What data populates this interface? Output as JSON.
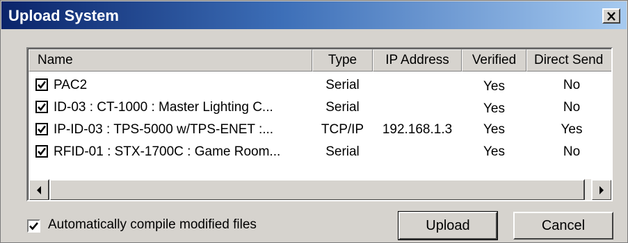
{
  "window": {
    "title": "Upload System"
  },
  "list": {
    "columns": [
      "Name",
      "Type",
      "IP Address",
      "Verified",
      "Direct Send"
    ],
    "rows": [
      {
        "checked": true,
        "name": "PAC2",
        "type": "Serial",
        "ip": "",
        "verified": "Yes",
        "direct_send": "No"
      },
      {
        "checked": true,
        "name": "ID-03 : CT-1000 : Master Lighting C...",
        "type": "Serial",
        "ip": "",
        "verified": "Yes",
        "direct_send": "No"
      },
      {
        "checked": true,
        "name": "IP-ID-03 : TPS-5000 w/TPS-ENET :...",
        "type": "TCP/IP",
        "ip": "192.168.1.3",
        "verified": "Yes",
        "direct_send": "Yes"
      },
      {
        "checked": true,
        "name": "RFID-01 : STX-1700C : Game Room...",
        "type": "Serial",
        "ip": "",
        "verified": "Yes",
        "direct_send": "No"
      }
    ]
  },
  "options": {
    "auto_compile_label": "Automatically compile modified files",
    "auto_compile_checked": true
  },
  "buttons": {
    "upload": "Upload",
    "cancel": "Cancel"
  },
  "icons": {
    "close": "close-icon",
    "scroll_left": "arrow-left-icon",
    "scroll_right": "arrow-right-icon",
    "check": "checkmark-icon"
  },
  "colors": {
    "titlebar_start": "#0a246a",
    "titlebar_end": "#a6caf0",
    "dialog_bg": "#d6d3ce"
  }
}
